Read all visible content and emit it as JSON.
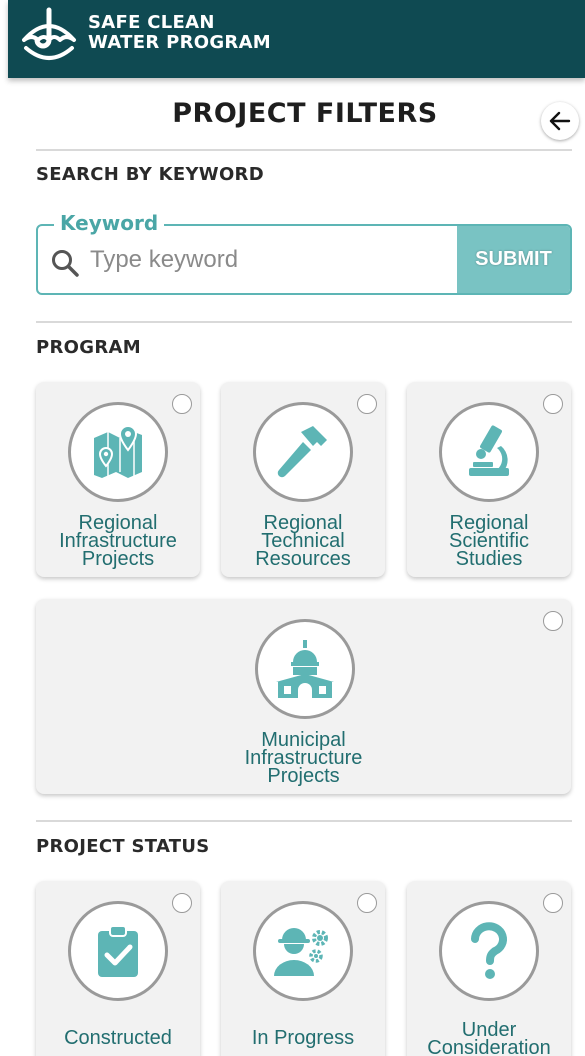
{
  "brand": {
    "line1": "SAFE CLEAN",
    "line2": "WATER PROGRAM"
  },
  "page_title": "PROJECT FILTERS",
  "search": {
    "section_label": "SEARCH BY KEYWORD",
    "field_label": "Keyword",
    "placeholder": "Type keyword",
    "value": "",
    "submit_label": "SUBMIT"
  },
  "program": {
    "section_label": "PROGRAM",
    "options": [
      {
        "label_lines": [
          "Regional",
          "Infrastructure",
          "Projects"
        ],
        "icon": "map-pin-icon",
        "selected": false
      },
      {
        "label_lines": [
          "Regional",
          "Technical",
          "Resources"
        ],
        "icon": "hammer-icon",
        "selected": false
      },
      {
        "label_lines": [
          "Regional",
          "Scientific",
          "Studies"
        ],
        "icon": "microscope-icon",
        "selected": false
      },
      {
        "label_lines": [
          "Municipal",
          "Infrastructure",
          "Projects"
        ],
        "icon": "municipal-building-icon",
        "selected": false
      }
    ]
  },
  "status": {
    "section_label": "PROJECT STATUS",
    "options": [
      {
        "label_lines": [
          "Constructed"
        ],
        "icon": "clipboard-check-icon",
        "selected": false
      },
      {
        "label_lines": [
          "In Progress"
        ],
        "icon": "worker-gears-icon",
        "selected": false
      },
      {
        "label_lines": [
          "Under",
          "Consideration"
        ],
        "icon": "question-mark-icon",
        "selected": false
      }
    ]
  },
  "colors": {
    "header": "#0f4a52",
    "accent": "#4aa6a6",
    "icon": "#5db5b5",
    "label": "#226e70"
  }
}
